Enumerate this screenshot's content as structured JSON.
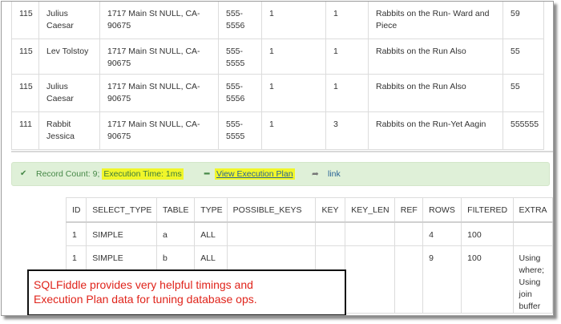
{
  "result_rows": [
    {
      "id": "115",
      "name": "Julius Caesar",
      "address": "1717 Main St NULL, CA-90675",
      "phone": "555-5556",
      "c5": "1",
      "c6": "1",
      "title": "Rabbits on the Run- Ward and Piece",
      "num": "59"
    },
    {
      "id": "115",
      "name": "Lev Tolstoy",
      "address": "1717 Main St NULL, CA-90675",
      "phone": "555-5555",
      "c5": "1",
      "c6": "1",
      "title": "Rabbits on the Run Also",
      "num": "55"
    },
    {
      "id": "115",
      "name": "Julius Caesar",
      "address": "1717 Main St NULL, CA-90675",
      "phone": "555-5556",
      "c5": "1",
      "c6": "1",
      "title": "Rabbits on the Run Also",
      "num": "55"
    },
    {
      "id": "111",
      "name": "Rabbit Jessica",
      "address": "1717 Main St NULL, CA-90675",
      "phone": "555-5555",
      "c5": "1",
      "c6": "3",
      "title": "Rabbits on the Run-Yet Aagin",
      "num": "555555"
    }
  ],
  "status": {
    "check_icon": "✔",
    "record_count": "Record Count: 9;",
    "execution_time": "Execution Time: 1ms",
    "minus_icon": "━",
    "view_plan": "View Execution Plan",
    "share_icon": "➦",
    "link": "link",
    "highlight_color": "#f0f62a",
    "success_bg": "#dff0d8"
  },
  "plan": {
    "headers": [
      "ID",
      "SELECT_TYPE",
      "TABLE",
      "TYPE",
      "POSSIBLE_KEYS",
      "KEY",
      "KEY_LEN",
      "REF",
      "ROWS",
      "FILTERED",
      "EXTRA"
    ],
    "rows": [
      [
        "1",
        "SIMPLE",
        "a",
        "ALL",
        "",
        "",
        "",
        "",
        "4",
        "100",
        ""
      ],
      [
        "1",
        "SIMPLE",
        "b",
        "ALL",
        "",
        "",
        "",
        "",
        "9",
        "100",
        "Using where; Using join buffer"
      ]
    ]
  },
  "callout": {
    "line1": "SQLFiddle provides very helpful timings and",
    "line2": "Execution Plan data for tuning database ops.",
    "color": "#e0241b"
  }
}
